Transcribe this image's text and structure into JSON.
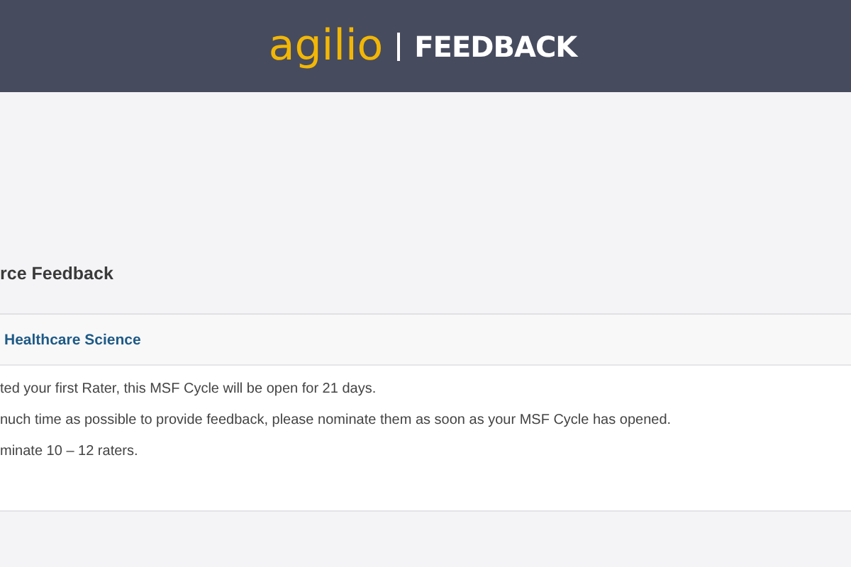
{
  "header": {
    "logo": "agilio",
    "product": "FEEDBACK"
  },
  "page_title": "rce Feedback",
  "card": {
    "title": "Healthcare Science",
    "lines": [
      "ted your first Rater, this MSF Cycle will be open for 21 days.",
      "nuch time as possible to provide feedback, please nominate them as soon as your MSF Cycle has opened.",
      "minate 10 – 12 raters."
    ]
  }
}
